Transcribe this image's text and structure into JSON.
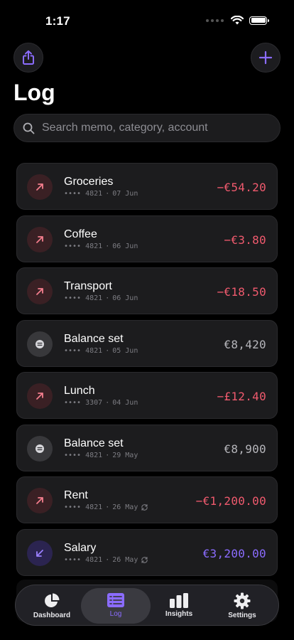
{
  "status_bar": {
    "time": "1:17"
  },
  "header": {
    "title": "Log"
  },
  "search": {
    "placeholder": "Search memo, category, account"
  },
  "transactions": [
    {
      "title": "Groceries",
      "card": "•••• 4821",
      "date": "07 Jun",
      "amount": "−€54.20",
      "kind": "expense",
      "recurring": false
    },
    {
      "title": "Coffee",
      "card": "•••• 4821",
      "date": "06 Jun",
      "amount": "−€3.80",
      "kind": "expense",
      "recurring": false
    },
    {
      "title": "Transport",
      "card": "•••• 4821",
      "date": "06 Jun",
      "amount": "−€18.50",
      "kind": "expense",
      "recurring": false
    },
    {
      "title": "Balance set",
      "card": "•••• 4821",
      "date": "05 Jun",
      "amount": "€8,420",
      "kind": "balance",
      "recurring": false
    },
    {
      "title": "Lunch",
      "card": "•••• 3307",
      "date": "04 Jun",
      "amount": "−£12.40",
      "kind": "expense",
      "recurring": false
    },
    {
      "title": "Balance set",
      "card": "•••• 4821",
      "date": "29 May",
      "amount": "€8,900",
      "kind": "balance",
      "recurring": false
    },
    {
      "title": "Rent",
      "card": "•••• 4821",
      "date": "26 May",
      "amount": "−€1,200.00",
      "kind": "expense",
      "recurring": true
    },
    {
      "title": "Salary",
      "card": "•••• 4821",
      "date": "26 May",
      "amount": "€3,200.00",
      "kind": "income",
      "recurring": true
    }
  ],
  "tabbar": {
    "tabs": [
      {
        "label": "Dashboard",
        "icon": "pie-chart-icon",
        "active": false
      },
      {
        "label": "Log",
        "icon": "list-icon",
        "active": true
      },
      {
        "label": "Insights",
        "icon": "bar-chart-icon",
        "active": false
      },
      {
        "label": "Settings",
        "icon": "gear-icon",
        "active": false
      }
    ]
  },
  "colors": {
    "accent": "#8b6cff",
    "expense": "#f05a6e",
    "neutral": "#b5b5ba",
    "background": "#000000",
    "card": "#1c1c1e"
  }
}
